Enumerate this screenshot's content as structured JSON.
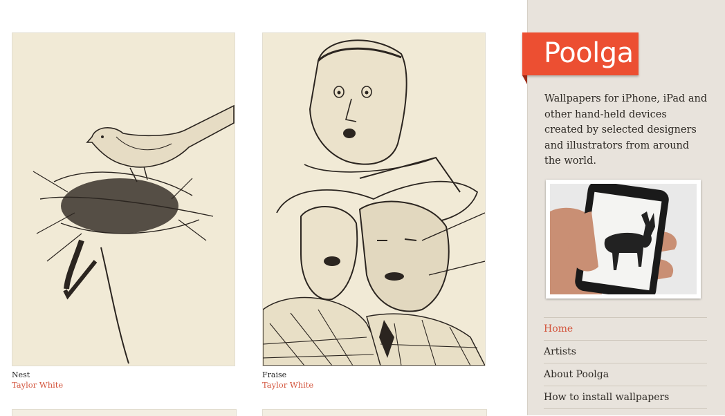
{
  "gallery": [
    {
      "title": "Nest",
      "author": "Taylor White",
      "art": "bird-on-nest-drawing"
    },
    {
      "title": "Fraise",
      "author": "Taylor White",
      "art": "men-faces-drawing"
    }
  ],
  "sidebar": {
    "logo": "Poolga",
    "intro": "Wallpapers for iPhone, iPad and other hand-held devices created by selected designers and illustrators from around the world.",
    "photo": "hand-holding-iphone-with-deer-wallpaper",
    "nav": [
      {
        "label": "Home",
        "active": true
      },
      {
        "label": "Artists",
        "active": false
      },
      {
        "label": "About Poolga",
        "active": false
      },
      {
        "label": "How to install wallpapers",
        "active": false
      }
    ]
  },
  "colors": {
    "accent": "#ec4f32",
    "link": "#d3543c",
    "sidebar_bg": "#e8e3dc",
    "paper": "#f1ead6",
    "ink": "#2b2520"
  }
}
